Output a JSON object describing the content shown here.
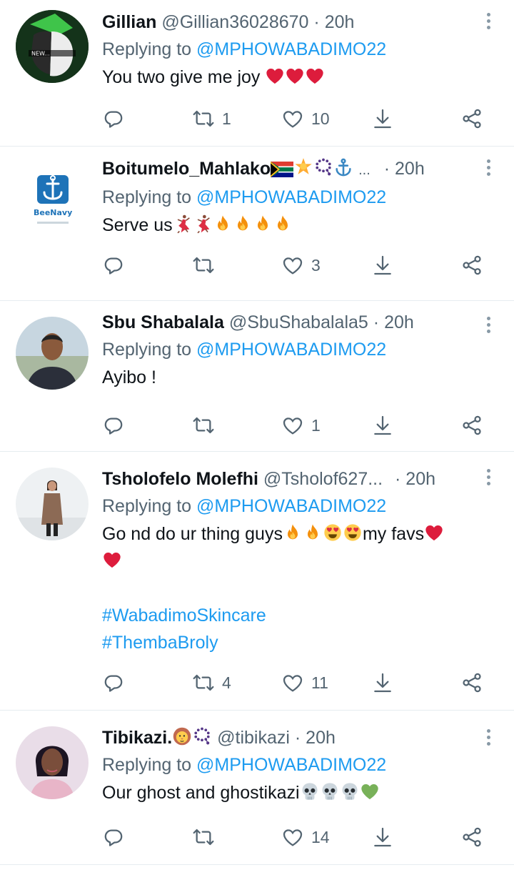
{
  "tweets": [
    {
      "name": "Gillian",
      "handle": "@Gillian36028670",
      "dot": "·",
      "time": "20h",
      "replying_prefix": "Replying to",
      "mention": "@MPHOWABADIMO22",
      "text": "You two give me joy",
      "emojis": [
        "heart",
        "heart",
        "heart"
      ],
      "retweets": "1",
      "likes": "10",
      "avatar_text": "NEW..."
    },
    {
      "name": "Boitumelo_Mahlako",
      "name_emojis": [
        "flag-za",
        "star",
        "prayer-beads",
        "anchor"
      ],
      "ellipsis": "...",
      "dot": "·",
      "time": "20h",
      "replying_prefix": "Replying to",
      "mention": "@MPHOWABADIMO22",
      "text": "Serve us",
      "emojis": [
        "dancer",
        "dancer",
        "fire",
        "fire",
        "fire",
        "fire"
      ],
      "retweets": "",
      "likes": "3",
      "avatar_text": "BeeNavy"
    },
    {
      "name": "Sbu Shabalala",
      "handle": "@SbuShabalala5",
      "dot": "·",
      "time": "20h",
      "replying_prefix": "Replying to",
      "mention": "@MPHOWABADIMO22",
      "text": "Ayibo !",
      "retweets": "",
      "likes": "1"
    },
    {
      "name": "Tsholofelo Molefhi",
      "handle": "@Tsholof627...",
      "dot": "·",
      "time": "20h",
      "replying_prefix": "Replying to",
      "mention": "@MPHOWABADIMO22",
      "text_part1": "Go nd do ur thing guys",
      "text_part2": "my favs",
      "hashtag1": "#WabadimoSkincare",
      "hashtag2": "#ThembaBroly",
      "retweets": "4",
      "likes": "11"
    },
    {
      "name": "Tibikazi.",
      "handle": "@tibikazi",
      "dot": "·",
      "time": "20h",
      "replying_prefix": "Replying to",
      "mention": "@MPHOWABADIMO22",
      "text": "Our ghost and ghostikazi",
      "retweets": "",
      "likes": "14"
    }
  ],
  "colors": {
    "accent": "#1d9bf0",
    "muted": "#536471",
    "heart": "#dd1c3c",
    "divider": "#e6ecf0"
  }
}
